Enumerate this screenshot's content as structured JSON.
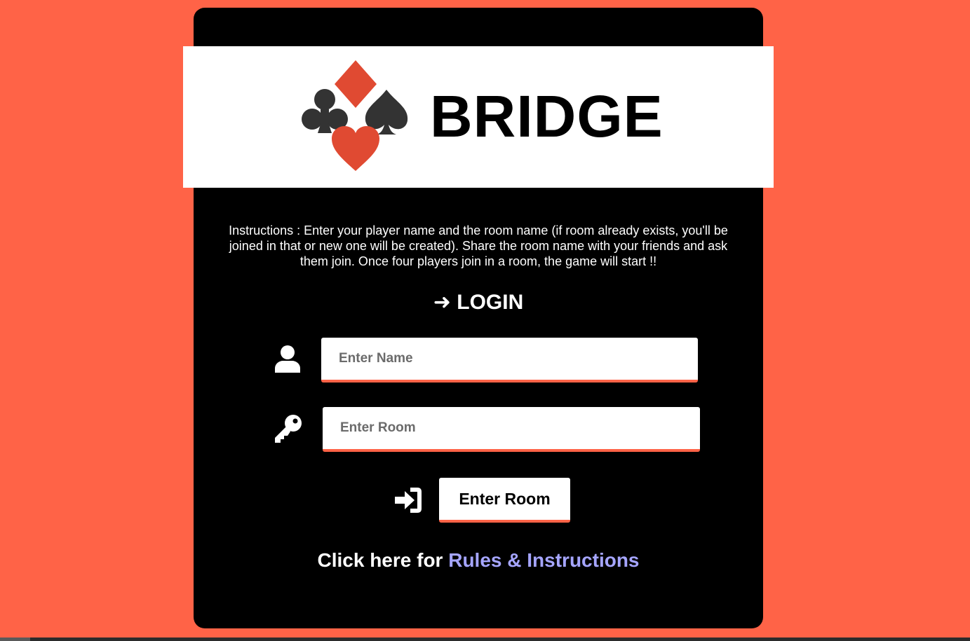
{
  "app": {
    "title": "BRIDGE"
  },
  "instructions": {
    "text": "Instructions : Enter your player name and the room name (if room already exists, you'll be joined in that or new one will be created). Share the room name with your friends and ask them join. Once four players join in a room, the game will start !!"
  },
  "login": {
    "heading": "➜ LOGIN",
    "name_field": {
      "placeholder": "Enter Name",
      "value": "",
      "icon": "user-icon"
    },
    "room_field": {
      "placeholder": "Enter Room",
      "value": "",
      "icon": "key-icon"
    },
    "submit": {
      "label": "Enter Room",
      "icon": "sign-in-icon"
    }
  },
  "rules": {
    "prefix": "Click here for ",
    "link_label": "Rules & Instructions"
  },
  "colors": {
    "background": "#ff6347",
    "card": "#000000",
    "accent": "#ff6347",
    "suit_red": "#e04a32",
    "suit_dark": "#333333",
    "link": "#a5a5ff"
  }
}
